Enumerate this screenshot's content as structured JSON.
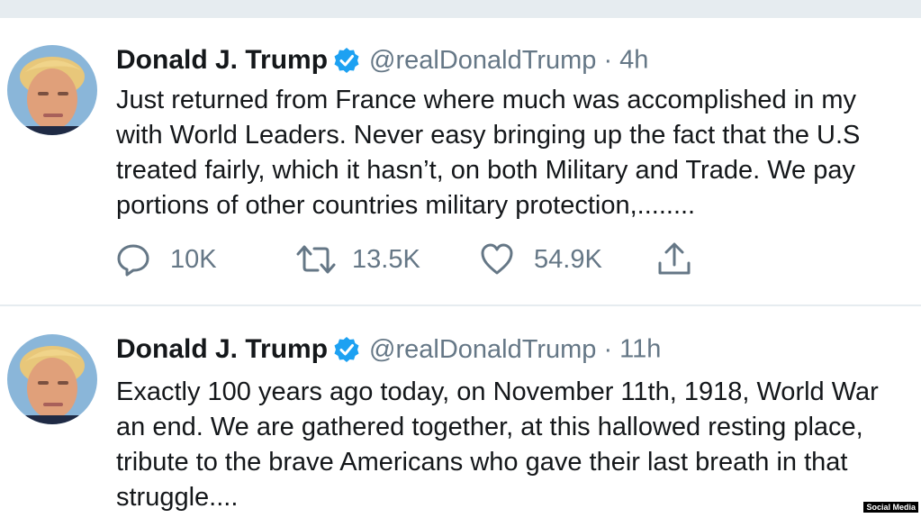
{
  "tweets": [
    {
      "author": "Donald J. Trump",
      "handle": "@realDonaldTrump",
      "separator": "·",
      "time": "4h",
      "lines": [
        "Just returned from France where much was accomplished in my",
        "with World Leaders. Never easy bringing up the fact that the U.S",
        "treated fairly, which it hasn’t, on both Military and Trade. We pay",
        "portions of other countries military protection,........"
      ],
      "replies": "10K",
      "retweets": "13.5K",
      "likes": "54.9K"
    },
    {
      "author": "Donald J. Trump",
      "handle": "@realDonaldTrump",
      "separator": "·",
      "time": "11h",
      "lines": [
        "Exactly 100 years ago today, on November 11th, 1918, World War",
        "an end. We are gathered together, at this hallowed resting place,",
        "tribute to the brave Americans who gave their last breath in that",
        "struggle...."
      ]
    }
  ],
  "watermark": "Social Media",
  "colors": {
    "text": "#14171a",
    "muted": "#657786",
    "verified": "#1da1f2",
    "separator": "#e6ecf0"
  },
  "icons": [
    "reply-icon",
    "retweet-icon",
    "like-icon",
    "share-icon",
    "verified-badge-icon"
  ]
}
